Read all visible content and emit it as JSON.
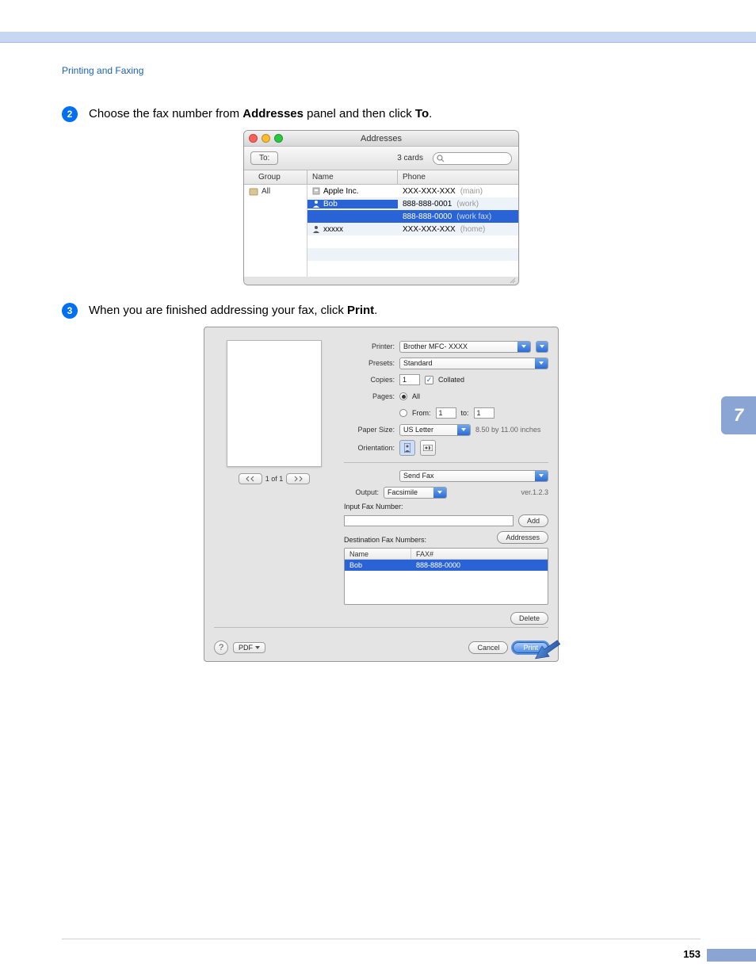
{
  "breadcrumb": "Printing and Faxing",
  "sideTab": "7",
  "pageNumber": "153",
  "step2": {
    "num": "2",
    "pre": "Choose the fax number from ",
    "b1": "Addresses",
    "mid": " panel and then click ",
    "b2": "To",
    "post": "."
  },
  "step3": {
    "num": "3",
    "pre": "When you are finished addressing your fax, click ",
    "b1": "Print",
    "post": "."
  },
  "addresses": {
    "title": "Addresses",
    "toBtn": "To:",
    "cards": "3 cards",
    "headers": {
      "group": "Group",
      "name": "Name",
      "phone": "Phone"
    },
    "groupAll": "All",
    "rows": [
      {
        "name": "Apple Inc.",
        "phone": "XXX-XXX-XXX",
        "type": "(main)"
      },
      {
        "name": "Bob",
        "phone": "888-888-0001",
        "type": "(work)"
      },
      {
        "name": "",
        "phone": "888-888-0000",
        "type": "(work fax)"
      },
      {
        "name": "xxxxx",
        "phone": "XXX-XXX-XXX",
        "type": "(home)"
      }
    ]
  },
  "print": {
    "labels": {
      "printer": "Printer:",
      "presets": "Presets:",
      "copies": "Copies:",
      "collated": "Collated",
      "pages": "Pages:",
      "all": "All",
      "from": "From:",
      "to": "to:",
      "paperSize": "Paper Size:",
      "orientation": "Orientation:",
      "output": "Output:",
      "inputFax": "Input Fax Number:",
      "destFax": "Destination Fax Numbers:",
      "name": "Name",
      "fax": "FAX#"
    },
    "values": {
      "printer": "Brother MFC- XXXX",
      "presets": "Standard",
      "copies": "1",
      "from": "1",
      "to": "1",
      "paperSize": "US Letter",
      "paperDim": "8.50 by 11.00 inches",
      "pane": "Send Fax",
      "output": "Facsimile",
      "ver": "ver.1.2.3",
      "destName": "Bob",
      "destFax": "888-888-0000",
      "pageNav": "1 of 1"
    },
    "buttons": {
      "add": "Add",
      "addresses": "Addresses",
      "delete": "Delete",
      "pdf": "PDF",
      "cancel": "Cancel",
      "print": "Print"
    }
  }
}
